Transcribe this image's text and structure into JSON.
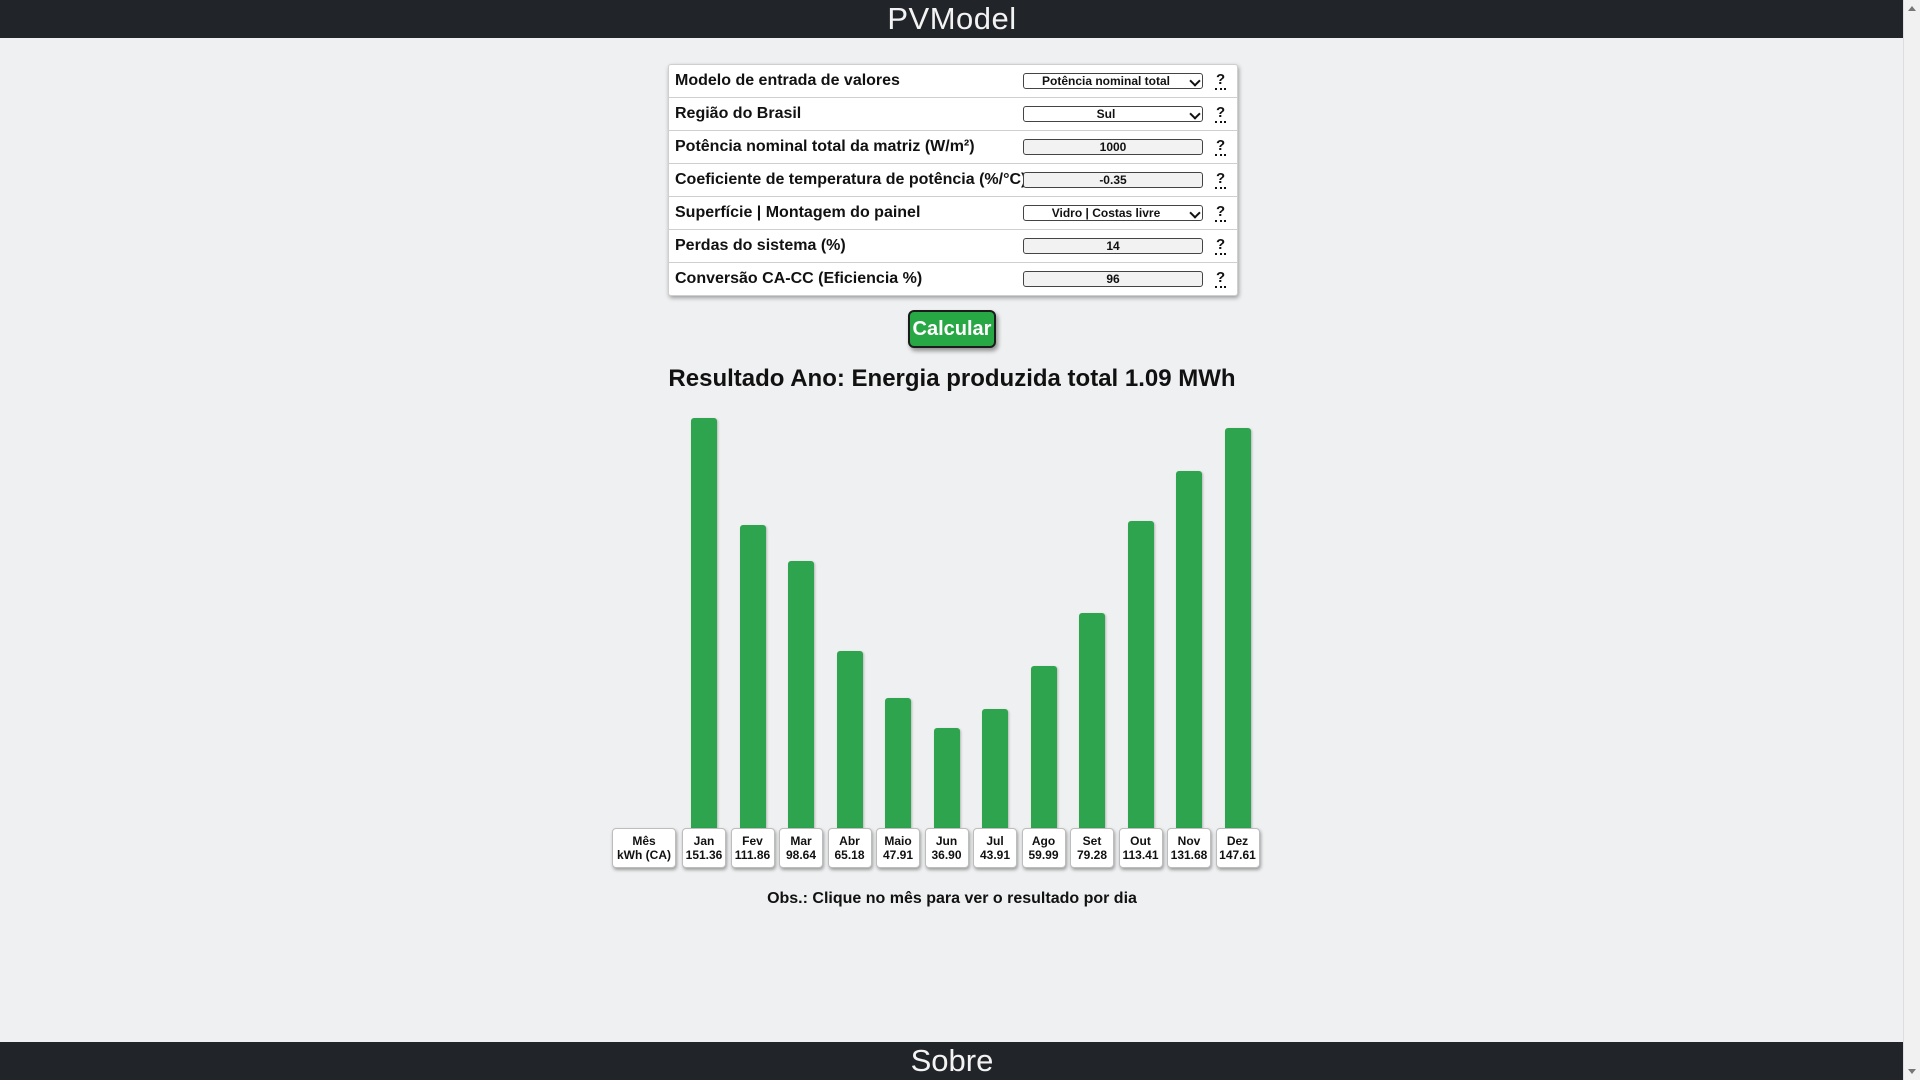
{
  "header": {
    "title": "PVModel"
  },
  "footer": {
    "title": "Sobre"
  },
  "params": [
    {
      "label": "Modelo de entrada de valores",
      "type": "select",
      "value": "Potência nominal total",
      "help": "?"
    },
    {
      "label": "Região do Brasil",
      "type": "select",
      "value": "Sul",
      "help": "?"
    },
    {
      "label": "Potência nominal total da matriz (W/m²)",
      "type": "input",
      "value": "1000",
      "help": "?"
    },
    {
      "label": "Coeficiente de temperatura de potência (%/°C)",
      "type": "input",
      "value": "-0.35",
      "help": "?"
    },
    {
      "label": "Superfície | Montagem do painel",
      "type": "select",
      "value": "Vidro | Costas livre",
      "help": "?"
    },
    {
      "label": "Perdas do sistema (%)",
      "type": "input",
      "value": "14",
      "help": "?"
    },
    {
      "label": "Conversão CA-CC (Eficiencia %)",
      "type": "input",
      "value": "96",
      "help": "?"
    }
  ],
  "calculate_label": "Calcular",
  "result_title": "Resultado Ano: Energia produzida total 1.09 MWh",
  "chart_header": {
    "line1": "Mês",
    "line2": "kWh (CA)"
  },
  "chart_data": {
    "type": "bar",
    "categories": [
      "Jan",
      "Fev",
      "Mar",
      "Abr",
      "Maio",
      "Jun",
      "Jul",
      "Ago",
      "Set",
      "Out",
      "Nov",
      "Dez"
    ],
    "values": [
      151.36,
      111.86,
      98.64,
      65.18,
      47.91,
      36.9,
      43.91,
      59.99,
      79.28,
      113.41,
      131.68,
      147.61
    ],
    "value_labels": [
      "151.36",
      "111.86",
      "98.64",
      "65.18",
      "47.91",
      "36.90",
      "43.91",
      "59.99",
      "79.28",
      "113.41",
      "131.68",
      "147.61"
    ],
    "ylim": [
      0,
      151.36
    ],
    "bar_color": "#2ea44f"
  },
  "note": "Obs.: Clique no mês para ver o resultado por dia"
}
